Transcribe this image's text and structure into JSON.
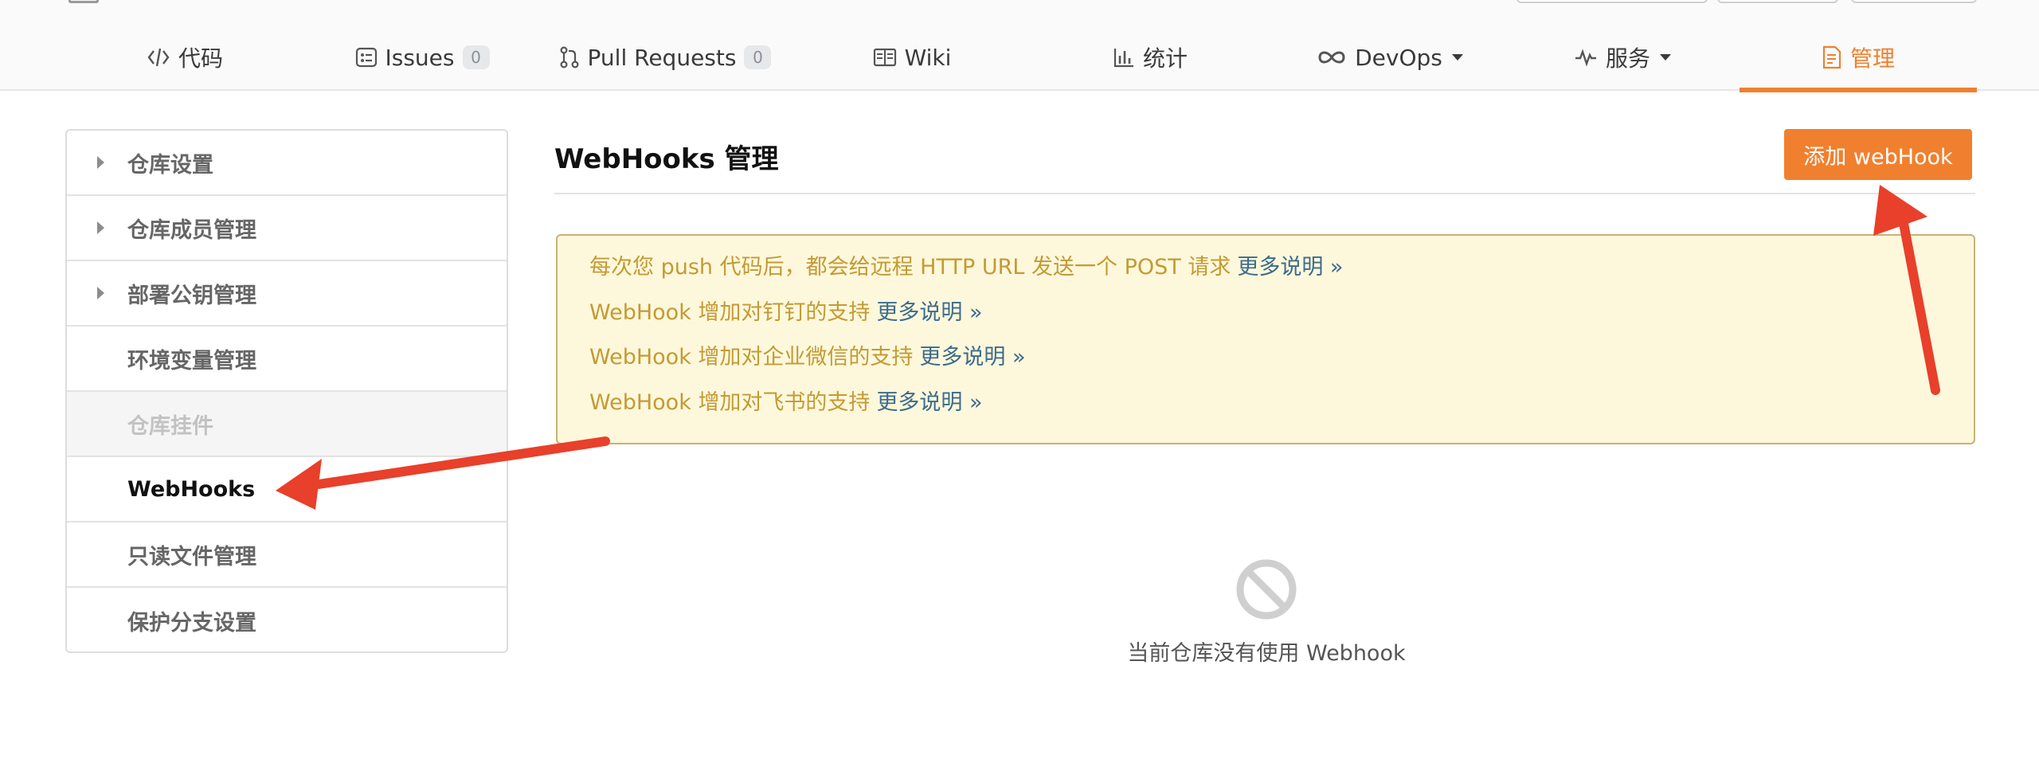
{
  "nav": {
    "items": [
      {
        "label": "代码",
        "icon": "code-icon",
        "badge": null,
        "caret": false,
        "active": false
      },
      {
        "label": "Issues",
        "icon": "issues-icon",
        "badge": "0",
        "caret": false,
        "active": false
      },
      {
        "label": "Pull Requests",
        "icon": "pull-request-icon",
        "badge": "0",
        "caret": false,
        "active": false
      },
      {
        "label": "Wiki",
        "icon": "wiki-book-icon",
        "badge": null,
        "caret": false,
        "active": false
      },
      {
        "label": "统计",
        "icon": "bar-chart-icon",
        "badge": null,
        "caret": false,
        "active": false
      },
      {
        "label": "DevOps",
        "icon": "infinity-icon",
        "badge": null,
        "caret": true,
        "active": false
      },
      {
        "label": "服务",
        "icon": "pulse-icon",
        "badge": null,
        "caret": true,
        "active": false
      },
      {
        "label": "管理",
        "icon": "settings-doc-icon",
        "badge": null,
        "caret": false,
        "active": true
      }
    ]
  },
  "sidebar": {
    "items": [
      {
        "label": "仓库设置",
        "expandable": true,
        "state": "normal"
      },
      {
        "label": "仓库成员管理",
        "expandable": true,
        "state": "normal"
      },
      {
        "label": "部署公钥管理",
        "expandable": true,
        "state": "normal"
      },
      {
        "label": "环境变量管理",
        "expandable": false,
        "state": "normal"
      },
      {
        "label": "仓库挂件",
        "expandable": false,
        "state": "disabled"
      },
      {
        "label": "WebHooks",
        "expandable": false,
        "state": "selected"
      },
      {
        "label": "只读文件管理",
        "expandable": false,
        "state": "normal"
      },
      {
        "label": "保护分支设置",
        "expandable": false,
        "state": "normal"
      }
    ]
  },
  "main": {
    "title": "WebHooks 管理",
    "add_button": "添加 webHook",
    "notices": [
      {
        "text": "每次您 push 代码后，都会给远程 HTTP URL 发送一个 POST 请求",
        "link": "更多说明 »"
      },
      {
        "text": "WebHook 增加对钉钉的支持",
        "link": "更多说明 »"
      },
      {
        "text": "WebHook 增加对企业微信的支持",
        "link": "更多说明 »"
      },
      {
        "text": "WebHook 增加对飞书的支持",
        "link": "更多说明 »"
      }
    ],
    "empty_icon": "prohibited-icon",
    "empty_text": "当前仓库没有使用 Webhook"
  },
  "colors": {
    "accent": "#f0802e",
    "notice_bg": "#fdf8dc",
    "notice_text": "#c49a34",
    "link": "#3c6b8c",
    "annotation_arrow": "#e8402a"
  }
}
